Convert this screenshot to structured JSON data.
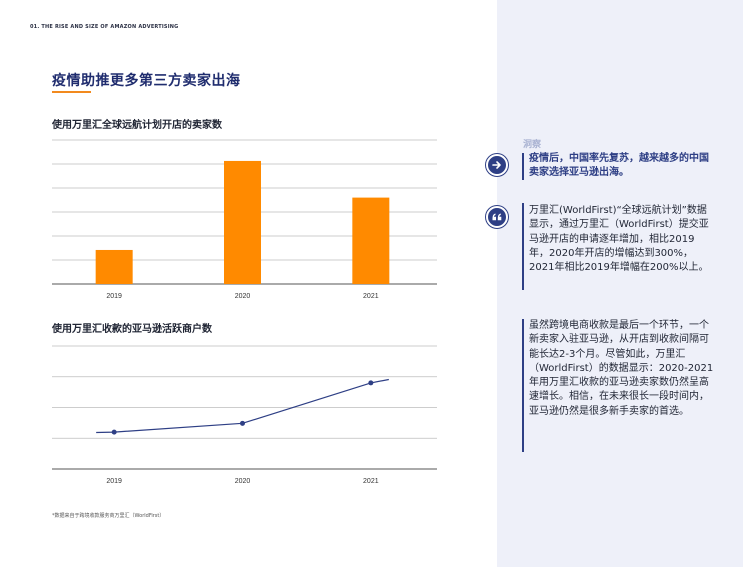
{
  "header": {
    "section_label": "01. THE RISE AND SIZE OF AMAZON ADVERTISING"
  },
  "main": {
    "title": "疫情助推更多第三方卖家出海"
  },
  "colors": {
    "accent": "#f28a1e",
    "navy": "#2e3f85",
    "panel_bg": "#eef0f9",
    "bar": "#ff8a00"
  },
  "chart_data": [
    {
      "type": "bar",
      "title": "使用万里汇全球远航计划开店的卖家数",
      "categories": [
        "2019",
        "2020",
        "2021"
      ],
      "values": [
        1.3,
        4.7,
        3.3
      ],
      "ylim": [
        0,
        5.5
      ],
      "grid": true,
      "y_tick_labels_shown": false
    },
    {
      "type": "line",
      "title": "使用万里汇收款的亚马逊活跃商户数",
      "categories": [
        "2019",
        "2020",
        "2021"
      ],
      "values": [
        1.05,
        1.3,
        2.45
      ],
      "ylim": [
        0,
        3.5
      ],
      "grid": true,
      "y_tick_labels_shown": false
    }
  ],
  "footnote": "*数据来自于跨境收款服务商万里汇（WorldFirst）",
  "sidebar": {
    "insight_label": "洞察",
    "insight_text": "疫情后，中国率先复苏，越来越多的中国卖家选择亚马逊出海。",
    "icons": [
      "arrow-right-icon",
      "quote-icon"
    ],
    "paragraph1": "万里汇(WorldFirst)“全球远航计划”数据显示，通过万里汇（WorldFirst）提交亚马逊开店的申请逐年增加，相比2019年，2020年开店的增幅达到300%，2021年相比2019年增幅在200%以上。",
    "paragraph2": "虽然跨境电商收款是最后一个环节，一个新卖家入驻亚马逊，从开店到收款间隔可能长达2-3个月。尽管如此，万里汇（WorldFirst）的数据显示：2020-2021年用万里汇收款的亚马逊卖家数仍然呈高速增长。相信，在未来很长一段时间内，亚马逊仍然是很多新手卖家的首选。"
  }
}
